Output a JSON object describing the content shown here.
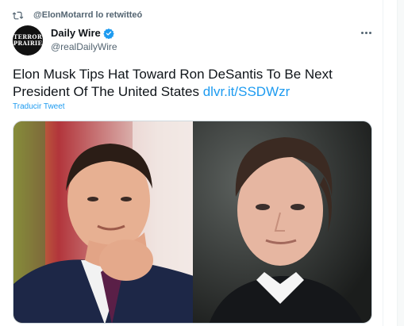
{
  "retweet": {
    "label": "@ElonMotarrd lo retwitteó",
    "icon": "retweet-icon"
  },
  "author": {
    "avatar_line1": "TERROR",
    "avatar_line2": "PRAIRIE",
    "display_name": "Daily Wire",
    "handle": "@realDailyWire",
    "verified": true
  },
  "tweet": {
    "text": "Elon Musk Tips Hat Toward Ron DeSantis To Be Next President Of The United States",
    "link_text": "dlvr.it/SSDWzr",
    "translate_label": "Traducir Tweet"
  },
  "media": {
    "images": [
      {
        "description_icon": "photo-icon"
      },
      {
        "description_icon": "photo-icon"
      }
    ]
  },
  "colors": {
    "accent": "#1d9bf0",
    "secondary_text": "#536471",
    "primary_text": "#0f1419",
    "border": "#cfd9de"
  }
}
